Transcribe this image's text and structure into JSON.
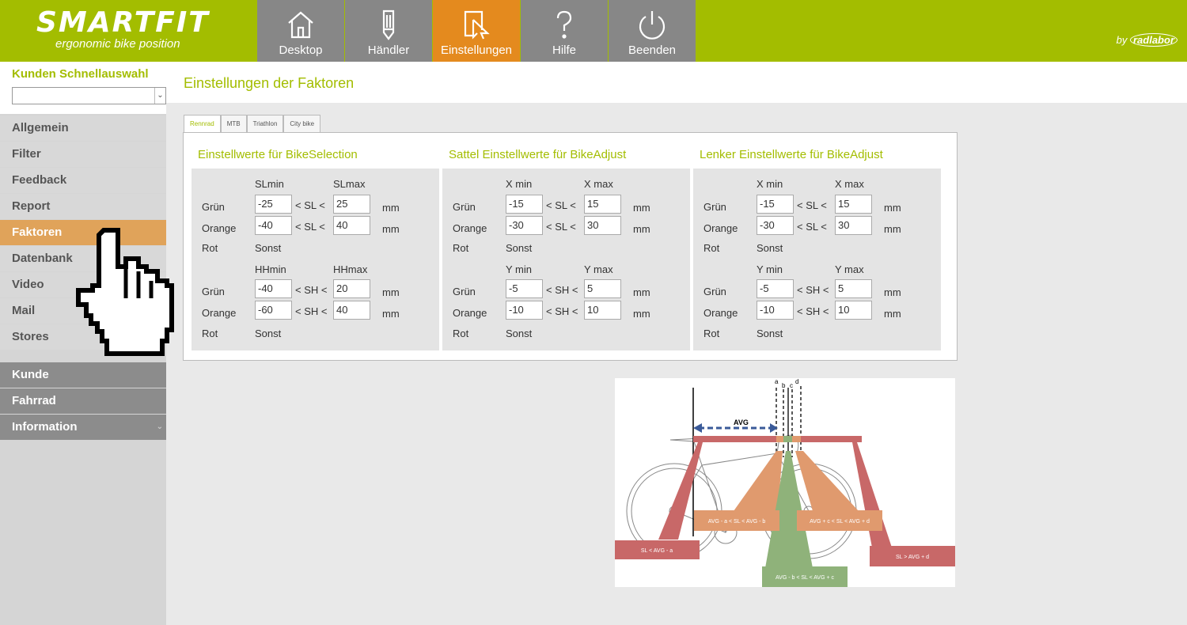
{
  "header": {
    "logo": "SMARTFIT",
    "tagline": "ergonomic bike position",
    "byline_prefix": "by",
    "byline_brand": "radlabor",
    "nav": [
      {
        "label": "Desktop",
        "icon": "home-icon"
      },
      {
        "label": "Händler",
        "icon": "pencil-icon"
      },
      {
        "label": "Einstellungen",
        "icon": "pointer-icon",
        "active": true
      },
      {
        "label": "Hilfe",
        "icon": "help-icon"
      },
      {
        "label": "Beenden",
        "icon": "power-icon"
      }
    ]
  },
  "sidebar": {
    "quick_label": "Kunden Schnellauswahl",
    "quick_value": "",
    "items": [
      "Allgemein",
      "Filter",
      "Feedback",
      "Report",
      "Faktoren",
      "Datenbank",
      "Video",
      "Mail",
      "Stores"
    ],
    "active_item": "Faktoren",
    "sections": [
      "Kunde",
      "Fahrrad",
      "Information"
    ]
  },
  "page": {
    "title": "Einstellungen der Faktoren",
    "tabs": [
      "Rennrad",
      "MTB",
      "Triathlon",
      "City bike"
    ],
    "active_tab": "Rennrad"
  },
  "sections": [
    {
      "title": "Einstellwerte für BikeSelection",
      "h1": [
        "SLmin",
        "SLmax"
      ],
      "r1": [
        [
          "Grün",
          "-25",
          "< SL <",
          "25",
          "mm"
        ],
        [
          "Orange",
          "-40",
          "< SL <",
          "40",
          "mm"
        ],
        [
          "Rot",
          "Sonst"
        ]
      ],
      "h2": [
        "HHmin",
        "HHmax"
      ],
      "r2": [
        [
          "Grün",
          "-40",
          "< SH <",
          "20",
          "mm"
        ],
        [
          "Orange",
          "-60",
          "< SH <",
          "40",
          "mm"
        ],
        [
          "Rot",
          "Sonst"
        ]
      ]
    },
    {
      "title": "Sattel Einstellwerte für BikeAdjust",
      "h1": [
        "X min",
        "X max"
      ],
      "r1": [
        [
          "Grün",
          "-15",
          "< SL <",
          "15",
          "mm"
        ],
        [
          "Orange",
          "-30",
          "< SL <",
          "30",
          "mm"
        ],
        [
          "Rot",
          "Sonst"
        ]
      ],
      "h2": [
        "Y min",
        "Y max"
      ],
      "r2": [
        [
          "Grün",
          "-5",
          "< SH <",
          "5",
          "mm"
        ],
        [
          "Orange",
          "-10",
          "< SH <",
          "10",
          "mm"
        ],
        [
          "Rot",
          "Sonst"
        ]
      ]
    },
    {
      "title": "Lenker Einstellwerte für BikeAdjust",
      "h1": [
        "X min",
        "X max"
      ],
      "r1": [
        [
          "Grün",
          "-15",
          "< SL <",
          "15",
          "mm"
        ],
        [
          "Orange",
          "-30",
          "< SL <",
          "30",
          "mm"
        ],
        [
          "Rot",
          "Sonst"
        ]
      ],
      "h2": [
        "Y min",
        "Y max"
      ],
      "r2": [
        [
          "Grün",
          "-5",
          "< SH <",
          "5",
          "mm"
        ],
        [
          "Orange",
          "-10",
          "< SH <",
          "10",
          "mm"
        ],
        [
          "Rot",
          "Sonst"
        ]
      ]
    }
  ],
  "diagram": {
    "letters": [
      "a",
      "b",
      "c",
      "d"
    ],
    "avg": "AVG",
    "labels": [
      "SL < AVG - a",
      "AVG - a < SL < AVG - b",
      "AVG + c < SL < AVG + d",
      "AVG - b < SL < AVG + c",
      "SL > AVG + d"
    ]
  },
  "colors": {
    "brand": "#a3bd00",
    "active": "#e48a1e",
    "green": "#8fb27a",
    "orange": "#e09a6e",
    "red": "#c86868"
  }
}
